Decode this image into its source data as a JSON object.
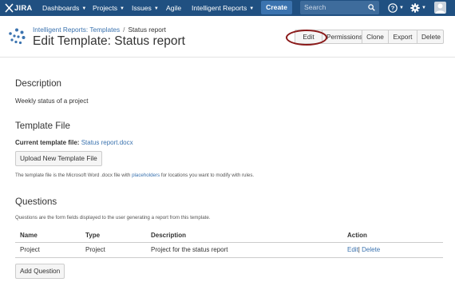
{
  "topnav": {
    "logo": "JIRA",
    "menus": [
      {
        "label": "Dashboards"
      },
      {
        "label": "Projects"
      },
      {
        "label": "Issues"
      },
      {
        "label": "Agile"
      },
      {
        "label": "Intelligent Reports"
      }
    ],
    "create_label": "Create",
    "search_placeholder": "Search"
  },
  "breadcrumb": {
    "parent": "Intelligent Reports: Templates",
    "separator": "/",
    "current": "Status report"
  },
  "page_title": "Edit Template: Status report",
  "actions": {
    "edit": "Edit",
    "permissions": "Permissions",
    "clone": "Clone",
    "export": "Export",
    "delete": "Delete"
  },
  "description": {
    "heading": "Description",
    "text": "Weekly status of a project"
  },
  "template_file": {
    "heading": "Template File",
    "current_label": "Current template file:",
    "file_name": "Status report.docx",
    "upload_label": "Upload New Template File",
    "help_prefix": "The template file is the Microsoft Word .docx file with",
    "help_link": "placeholders",
    "help_suffix": "for locations you want to modify with rules."
  },
  "questions": {
    "heading": "Questions",
    "help": "Questions are the form fields displayed to the user generating a report from this template.",
    "columns": {
      "name": "Name",
      "type": "Type",
      "description": "Description",
      "action": "Action"
    },
    "rows": [
      {
        "name": "Project",
        "type": "Project",
        "description": "Project for the status report",
        "edit": "Edit",
        "sep": "|",
        "delete": "Delete"
      }
    ],
    "add_label": "Add Question"
  },
  "colors": {
    "nav_bg": "#205081",
    "create_bg": "#3b73af",
    "link": "#3b73af",
    "highlight_oval": "#8b1a1a"
  }
}
